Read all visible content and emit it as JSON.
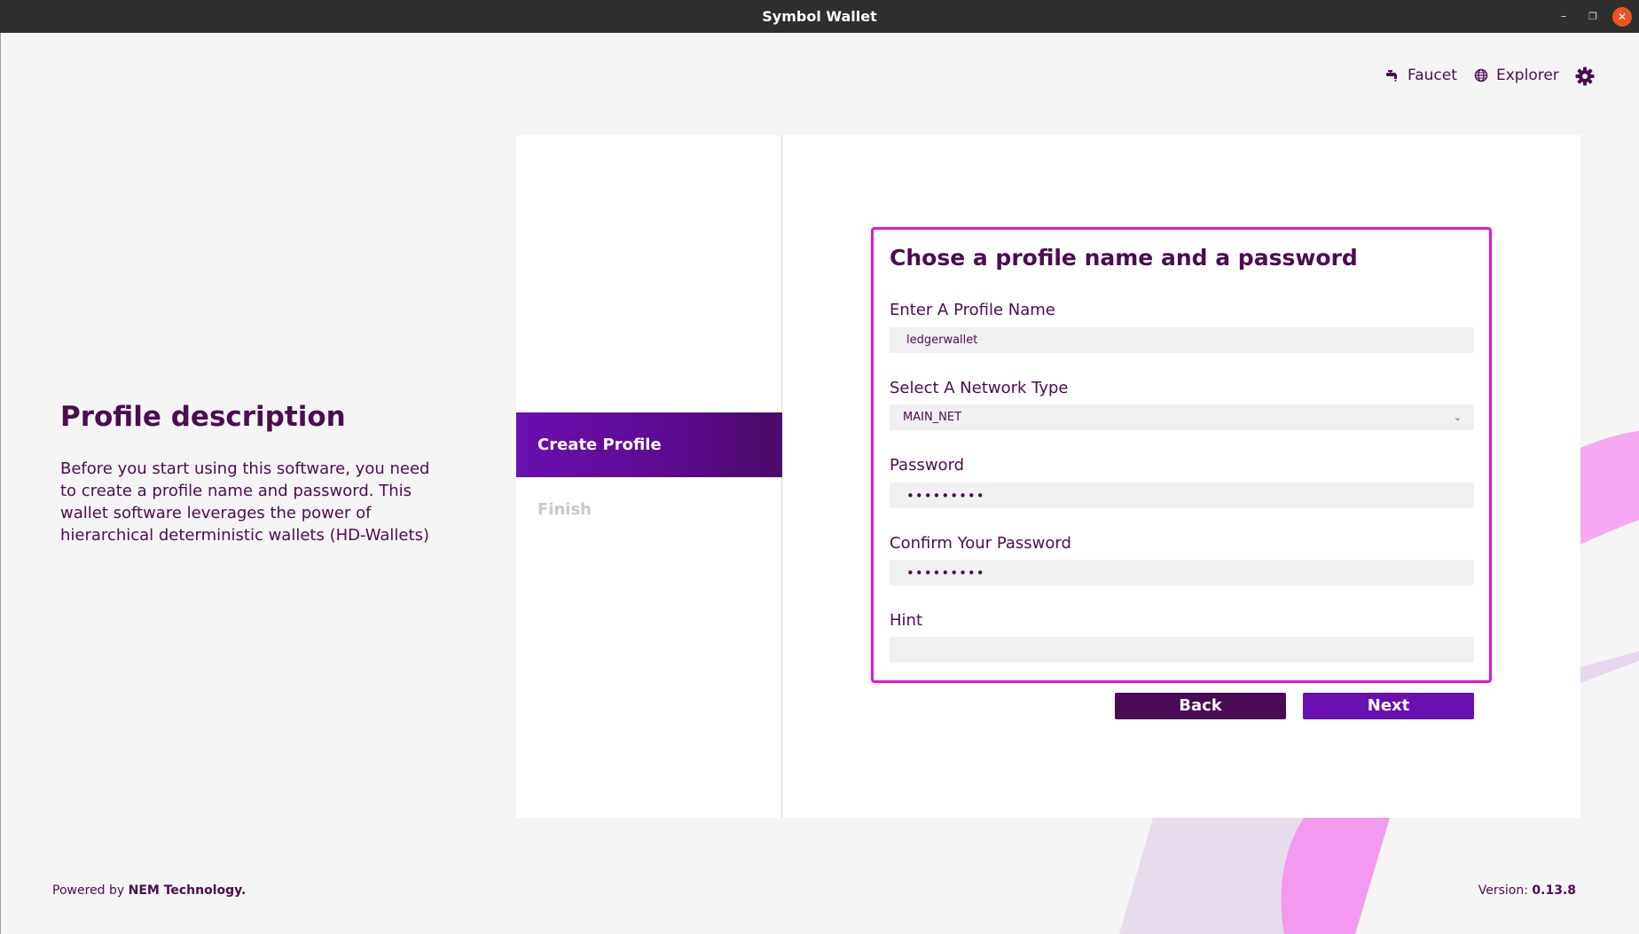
{
  "window": {
    "title": "Symbol Wallet",
    "minimize_glyph": "–",
    "maximize_glyph": "❐",
    "close_glyph": "✕"
  },
  "topnav": {
    "faucet_label": "Faucet",
    "faucet_icon": "faucet-icon",
    "explorer_label": "Explorer",
    "explorer_icon": "globe-icon",
    "settings_icon": "gear-icon"
  },
  "description": {
    "title": "Profile description",
    "body": "Before you start using this software, you need to create a profile name and password. This wallet software leverages the power of hierarchical deterministic wallets (HD-Wallets)"
  },
  "steps": {
    "items": [
      {
        "label": "Create Profile",
        "active": true
      },
      {
        "label": "Finish",
        "active": false
      }
    ]
  },
  "form": {
    "title": "Chose a profile name and a password",
    "profile_name_label": "Enter A Profile Name",
    "profile_name_value": "ledgerwallet",
    "network_label": "Select A Network Type",
    "network_value": "MAIN_NET",
    "password_label": "Password",
    "password_value": "•••••••••",
    "confirm_label": "Confirm Your Password",
    "confirm_value": "•••••••••",
    "hint_label": "Hint",
    "hint_value": ""
  },
  "buttons": {
    "back": "Back",
    "next": "Next"
  },
  "footer": {
    "powered_prefix": "Powered by",
    "powered_brand": "NEM Technology.",
    "version_prefix": "Version:",
    "version_value": "0.13.8"
  },
  "colors": {
    "brand": "#4a0e4e",
    "accent": "#6a0fb0",
    "highlight_border": "#e614d6",
    "close_button": "#e95420"
  }
}
